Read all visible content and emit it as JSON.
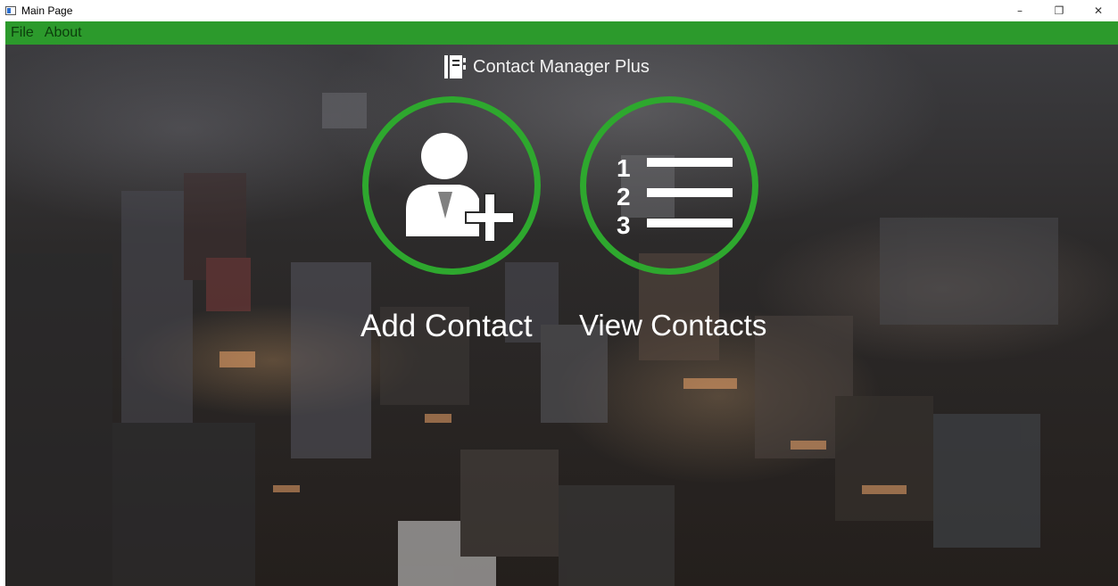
{
  "window": {
    "title": "Main Page",
    "controls": {
      "minimize": "–",
      "maximize": "❐",
      "close": "✕"
    }
  },
  "menu": {
    "items": [
      "File",
      "About"
    ]
  },
  "app": {
    "title": "Contact Manager Plus",
    "title_icon": "contact-book-icon"
  },
  "actions": {
    "add_contact": {
      "label": "Add Contact",
      "icon": "add-user-icon"
    },
    "view_contacts": {
      "label": "View Contacts",
      "icon": "numbered-list-icon",
      "numbers": [
        "1",
        "2",
        "3"
      ]
    }
  },
  "colors": {
    "accent": "#2ea82e",
    "menubar": "#2c9a2c",
    "menu_text": "#0c3d0c",
    "label_text": "#ffffff"
  }
}
